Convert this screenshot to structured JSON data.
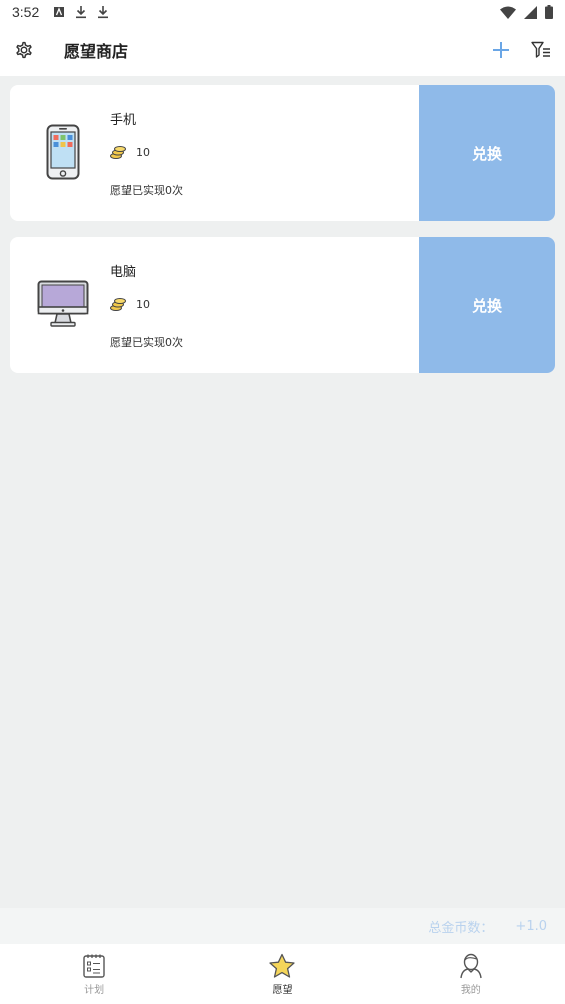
{
  "status_bar": {
    "time": "3:52"
  },
  "header": {
    "title": "愿望商店"
  },
  "wishes": [
    {
      "name": "手机",
      "price": "10",
      "status": "愿望已实现0次",
      "button": "兑换",
      "icon": "phone-icon"
    },
    {
      "name": "电脑",
      "price": "10",
      "status": "愿望已实现0次",
      "button": "兑换",
      "icon": "computer-icon"
    }
  ],
  "summary": {
    "label": "总金币数：",
    "value": "+1.0"
  },
  "bottom_nav": [
    {
      "label": "计划",
      "icon": "checklist-icon",
      "active": false
    },
    {
      "label": "愿望",
      "icon": "star-icon",
      "active": true
    },
    {
      "label": "我的",
      "icon": "user-icon",
      "active": false
    }
  ],
  "colors": {
    "accent": "#8fbae9",
    "background": "#eef0f0"
  }
}
